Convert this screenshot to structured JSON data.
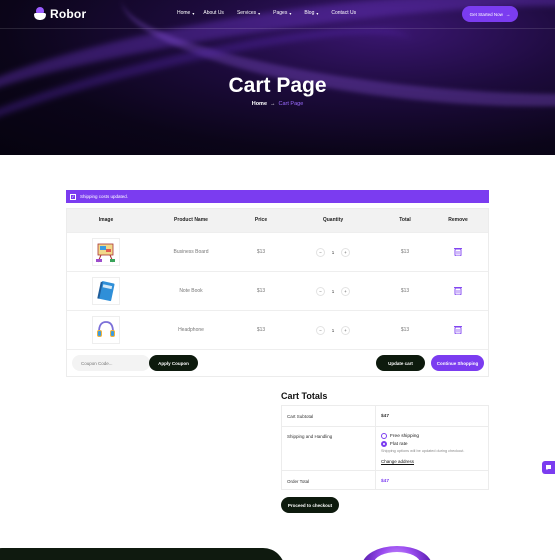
{
  "brand": {
    "name": "Robor"
  },
  "nav": {
    "items": [
      {
        "label": "Home",
        "dropdown": true
      },
      {
        "label": "About Us",
        "dropdown": false
      },
      {
        "label": "Services",
        "dropdown": true
      },
      {
        "label": "Pages",
        "dropdown": true
      },
      {
        "label": "Blog",
        "dropdown": true
      },
      {
        "label": "Contact Us",
        "dropdown": false
      }
    ],
    "cta_label": "Get Started Now",
    "cta_arrow": "→"
  },
  "hero": {
    "title": "Cart Page",
    "breadcrumb": {
      "home": "Home",
      "arrow": "→",
      "current": "Cart Page"
    }
  },
  "notice": {
    "text": "Shipping costs updated.",
    "icon": "check-icon"
  },
  "cart": {
    "headers": [
      "Image",
      "Product Name",
      "Price",
      "Quantity",
      "Total",
      "Remove"
    ],
    "rows": [
      {
        "image": "easel-icon",
        "name": "Business Board",
        "price": "$13",
        "qty": "1",
        "total": "$13"
      },
      {
        "image": "notebook-icon",
        "name": "Note Book",
        "price": "$13",
        "qty": "1",
        "total": "$13"
      },
      {
        "image": "headphone-icon",
        "name": "Headphone",
        "price": "$13",
        "qty": "1",
        "total": "$13"
      }
    ],
    "qty_minus": "−",
    "qty_plus": "+",
    "coupon_placeholder": "Coupon Code...",
    "apply_label": "Apply Coupon",
    "update_label": "Update cart",
    "continue_label": "Continue Shopping"
  },
  "totals": {
    "title": "Cart Totals",
    "subtotal_label": "Cart Subtotal",
    "subtotal_value": "$47",
    "shipping_label": "Shipping and Handling",
    "options": [
      {
        "label": "Free shipping",
        "selected": false
      },
      {
        "label": "Flat rate",
        "selected": true
      }
    ],
    "shipping_note": "Shipping options will be updated during checkout.",
    "change_address": "Change address",
    "order_total_label": "Order Total",
    "order_total_value": "$47",
    "checkout_label": "Proceed to checkout"
  },
  "colors": {
    "accent": "#7b3cf0",
    "dark": "#0d1a0d",
    "hero_bg": "#0b0519"
  }
}
